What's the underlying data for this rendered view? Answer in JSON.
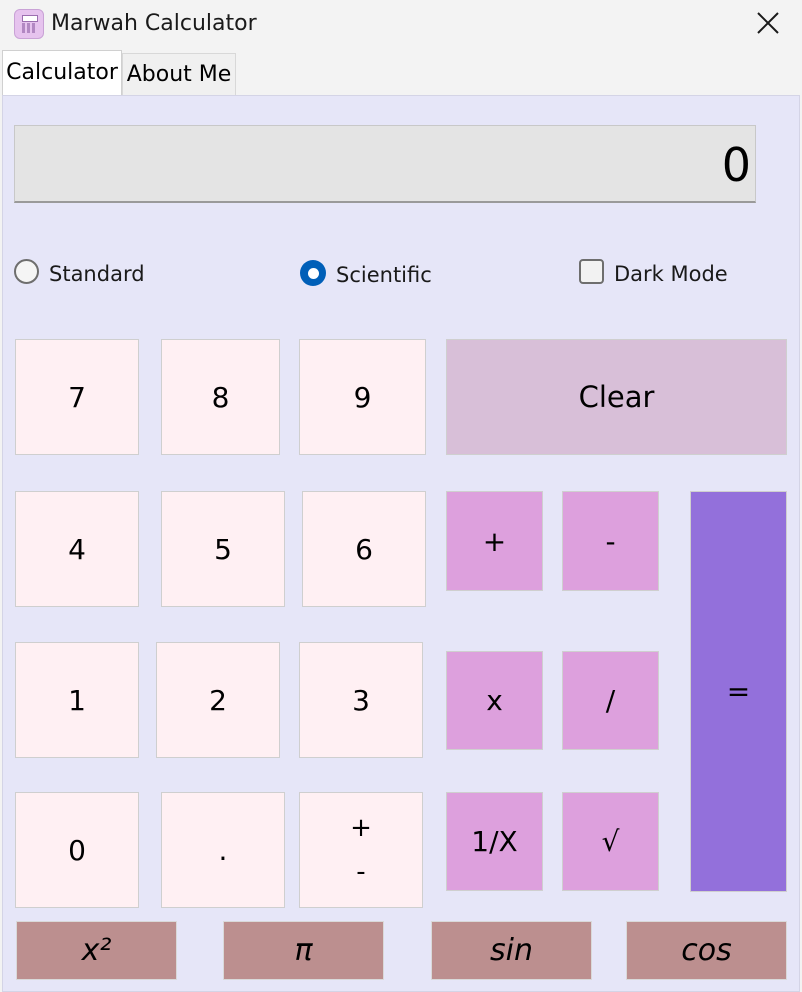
{
  "window": {
    "title": "Marwah Calculator"
  },
  "tabs": [
    {
      "label": "Calculator"
    },
    {
      "label": "About Me"
    }
  ],
  "display": {
    "value": "0"
  },
  "modes": {
    "standard": "Standard",
    "scientific": "Scientific",
    "selected": "Scientific",
    "dark_mode": "Dark Mode",
    "dark_mode_checked": false
  },
  "keys": {
    "seven": "7",
    "eight": "8",
    "nine": "9",
    "four": "4",
    "five": "5",
    "six": "6",
    "one": "1",
    "two": "2",
    "three": "3",
    "zero": "0",
    "dot": ".",
    "plus_minus_top": "+",
    "plus_minus_bottom": "-",
    "clear": "Clear",
    "plus": "+",
    "minus": "-",
    "multiply": "x",
    "divide": "/",
    "reciprocal": "1/X",
    "sqrt": "√",
    "equals": "=",
    "square": "x²",
    "pi": "π",
    "sin": "sin",
    "cos": "cos"
  },
  "colors": {
    "number_key": "#fff0f3",
    "operator_key": "#dda0dd",
    "clear_key": "#d8bfd8",
    "equals_key": "#9370db",
    "scientific_key": "#bc8f8f",
    "panel_bg": "#e6e6f8",
    "radio_selected": "#005fb8"
  }
}
